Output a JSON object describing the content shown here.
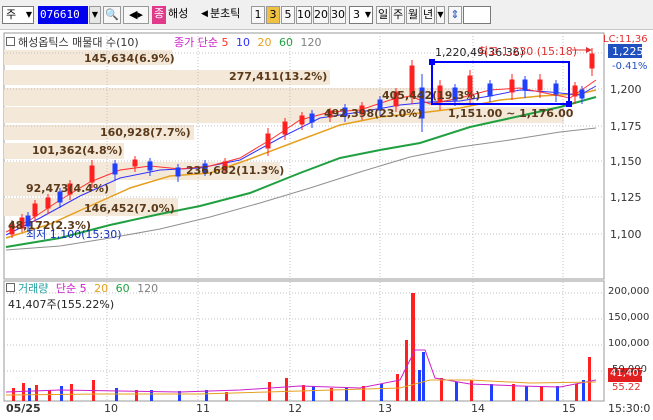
{
  "toolbar": {
    "market_type": "주",
    "stock_code": "076610",
    "stock_badge": "종",
    "stock_name": "해성",
    "period_label": "분초틱",
    "period_buttons": [
      "1",
      "3",
      "5",
      "10",
      "20",
      "30"
    ],
    "period_selected": "3",
    "interval_value": "3",
    "timeframe_buttons": [
      "일",
      "주",
      "월",
      "년"
    ]
  },
  "price_panel": {
    "title": "해성옵틱스 매물대 수(10)",
    "legend_prefix": "종가 단순",
    "ma_periods": [
      "5",
      "10",
      "20",
      "60",
      "120"
    ],
    "ma_colors": [
      "#ff3030",
      "#3030ff",
      "#e6a020",
      "#20a040",
      "#808080"
    ],
    "axis_labels": [
      "1,225",
      "1,200",
      "1,175",
      "1,150",
      "1,125",
      "1,100"
    ],
    "current_price": "1,225",
    "change_pct": "-0.41%",
    "lc_label": "LC:11,36",
    "high_annotation": "최고 1,230 (15:18)",
    "low_annotation": "최저 1,100(15:30)",
    "range_annotation": "1,220,49(36.36)",
    "band_annotation": "492,398(23.0%)",
    "band_range": "1,151.00 ~ 1,176.00",
    "volume_profile": [
      {
        "label": "145,634(6.9%)"
      },
      {
        "label": "277,411(13.2%)"
      },
      {
        "label": "405,442(19.3%)"
      },
      {
        "label": "160,928(7.7%)"
      },
      {
        "label": "101,362(4.8%)"
      },
      {
        "label": "236,682(11.3%)"
      },
      {
        "label": "92,473(4.4%)"
      },
      {
        "label": "146,452(7.0%)"
      },
      {
        "label": "48,172(2.3%)"
      }
    ]
  },
  "volume_panel": {
    "title": "거래량",
    "legend_prefix": "단순",
    "ma_periods": [
      "5",
      "20",
      "60",
      "120"
    ],
    "current_value": "41,407주(155.22%)",
    "axis_labels": [
      "200,000",
      "150,000",
      "100,000",
      "50,000"
    ],
    "current_volume": "41,407",
    "current_pct": "55.22"
  },
  "x_axis": {
    "labels": [
      "05/25",
      "10",
      "11",
      "12",
      "13",
      "14",
      "15"
    ],
    "end_time": "15:30:0"
  }
}
